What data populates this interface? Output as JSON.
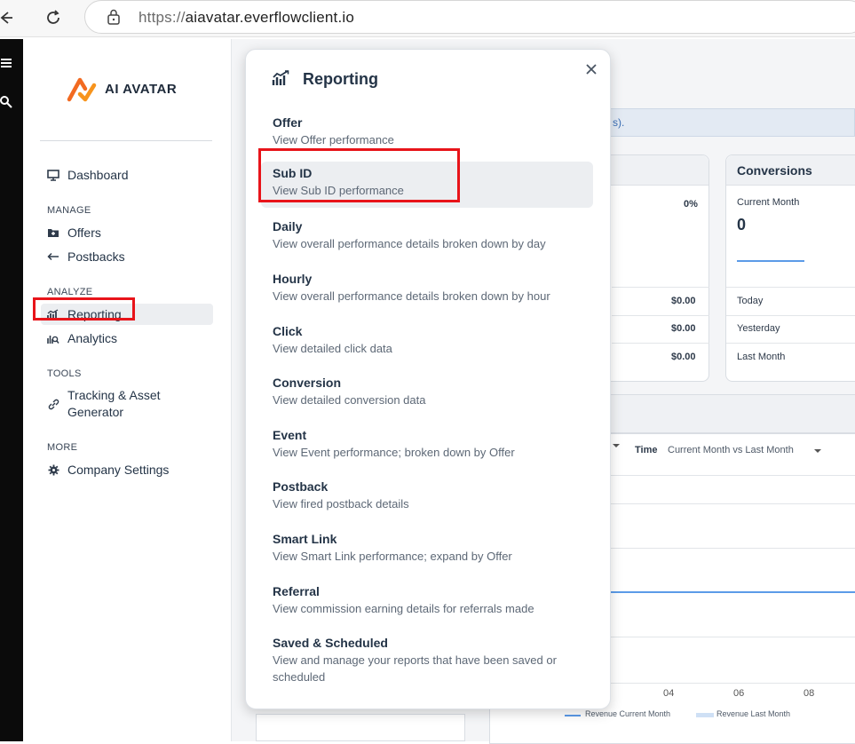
{
  "browser": {
    "url_protocol": "https://",
    "url_host": "aiavatar.everflowclient.io"
  },
  "sidebar": {
    "logo_text": "AI AVATAR",
    "items": {
      "dashboard": "Dashboard",
      "offers": "Offers",
      "postbacks": "Postbacks",
      "reporting": "Reporting",
      "analytics": "Analytics",
      "tracking_line1": "Tracking & Asset",
      "tracking_line2": "Generator",
      "company_settings": "Company Settings"
    },
    "sections": {
      "manage": "MANAGE",
      "analyze": "ANALYZE",
      "tools": "TOOLS",
      "more": "MORE"
    }
  },
  "background": {
    "notice_tail": "s).",
    "percent_value": "0%",
    "amounts": [
      "$0.00",
      "$0.00",
      "$0.00"
    ],
    "conversions_card": {
      "title": "Conversions",
      "current_month_label": "Current Month",
      "current_month_value": "0",
      "today": "Today",
      "yesterday": "Yesterday",
      "last_month": "Last Month"
    },
    "chart": {
      "time_label": "Time",
      "time_value": "Current Month vs Last Month",
      "x_ticks": [
        "04",
        "06",
        "08"
      ],
      "legend_current": "Revenue Current Month",
      "legend_last": "Revenue Last Month"
    }
  },
  "popup": {
    "title": "Reporting",
    "entries": [
      {
        "label": "Offer",
        "desc": "View Offer performance"
      },
      {
        "label": "Sub ID",
        "desc": "View Sub ID performance"
      },
      {
        "label": "Daily",
        "desc": "View overall performance details broken down by day"
      },
      {
        "label": "Hourly",
        "desc": "View overall performance details broken down by hour"
      },
      {
        "label": "Click",
        "desc": "View detailed click data"
      },
      {
        "label": "Conversion",
        "desc": "View detailed conversion data"
      },
      {
        "label": "Event",
        "desc": "View Event performance; broken down by Offer"
      },
      {
        "label": "Postback",
        "desc": "View fired postback details"
      },
      {
        "label": "Smart Link",
        "desc": "View Smart Link performance; expand by Offer"
      },
      {
        "label": "Referral",
        "desc": "View commission earning details for referrals made"
      },
      {
        "label": "Saved & Scheduled",
        "desc_line1": "View and manage your reports that have been saved or",
        "desc_line2": "scheduled"
      }
    ]
  },
  "colors": {
    "highlight_red": "#e8141a",
    "logo_orange": "#f26a21",
    "chart_line": "#5b9be8"
  }
}
